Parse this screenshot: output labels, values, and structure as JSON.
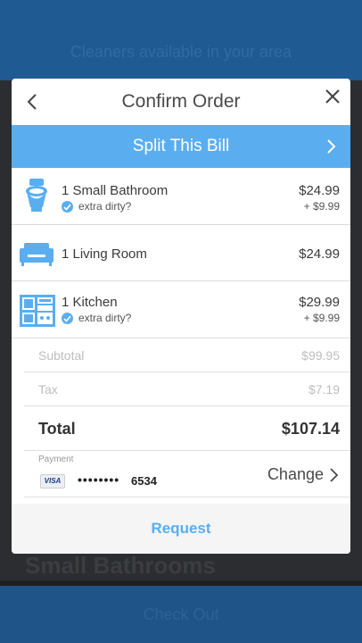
{
  "background": {
    "banner_text": "Cleaners available in your area",
    "row_text": "Small Bathrooms",
    "bottom_text": "Check Out"
  },
  "modal": {
    "title": "Confirm Order",
    "split_label": "Split This Bill",
    "items": [
      {
        "icon": "toilet-icon",
        "name": "1 Small Bathroom",
        "price": "$24.99",
        "extra_label": "extra dirty?",
        "extra_price": "+ $9.99"
      },
      {
        "icon": "sofa-icon",
        "name": "1 Living Room",
        "price": "$24.99"
      },
      {
        "icon": "kitchen-icon",
        "name": "1 Kitchen",
        "price": "$29.99",
        "extra_label": "extra dirty?",
        "extra_price": "+ $9.99"
      }
    ],
    "subtotal_label": "Subtotal",
    "subtotal_value": "$99.95",
    "tax_label": "Tax",
    "tax_value": "$7.19",
    "total_label": "Total",
    "total_value": "$107.14",
    "payment": {
      "label": "Payment",
      "card_brand": "VISA",
      "masked": "••••••••",
      "last4": "6534",
      "change_label": "Change"
    },
    "request_label": "Request"
  },
  "colors": {
    "accent": "#5aaef0",
    "app_blue": "#1f5a92",
    "text": "#3a3a3a",
    "muted": "#bdbdbd"
  }
}
